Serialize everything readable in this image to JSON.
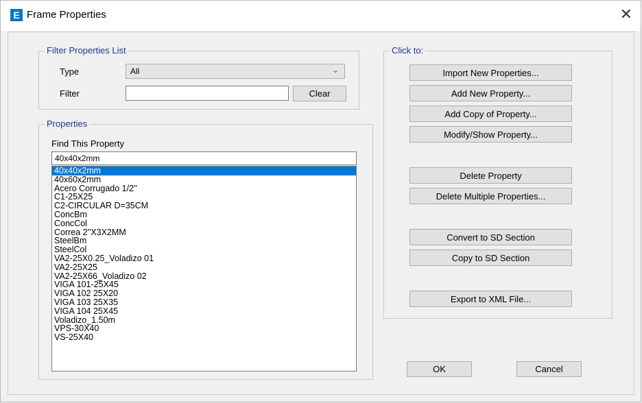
{
  "window": {
    "icon_letter": "E",
    "title": "Frame Properties",
    "close_glyph": "✕"
  },
  "filter": {
    "legend": "Filter Properties List",
    "type_label": "Type",
    "type_value": "All",
    "filter_label": "Filter",
    "filter_value": "",
    "clear_label": "Clear"
  },
  "properties": {
    "legend": "Properties",
    "find_label": "Find This Property",
    "find_value": "40x40x2mm",
    "selected_index": 0,
    "items": [
      "40x40x2mm",
      "40x60x2mm",
      "Acero Corrugado 1/2''",
      "C1-25X25",
      "C2-CIRCULAR D=35CM",
      "ConcBm",
      "ConcCol",
      "Correa 2''X3X2MM",
      "SteelBm",
      "SteelCol",
      "VA2-25X0.25_Voladizo 01",
      "VA2-25X25",
      "VA2-25X66_Voladizo 02",
      "VIGA 101-25X45",
      "VIGA 102 25X20",
      "VIGA 103 25X35",
      "VIGA 104 25X45",
      "Voladizo_1.50m",
      "VPS-30X40",
      "VS-25X40"
    ]
  },
  "click_to": {
    "legend": "Click to:",
    "buttons": {
      "import": "Import New Properties...",
      "add_new": "Add New Property...",
      "add_copy": "Add Copy of Property...",
      "modify": "Modify/Show Property...",
      "delete": "Delete Property",
      "delete_multiple": "Delete Multiple Properties...",
      "convert_sd": "Convert to SD Section",
      "copy_sd": "Copy to SD Section",
      "export_xml": "Export to XML File..."
    }
  },
  "footer": {
    "ok_label": "OK",
    "cancel_label": "Cancel"
  }
}
